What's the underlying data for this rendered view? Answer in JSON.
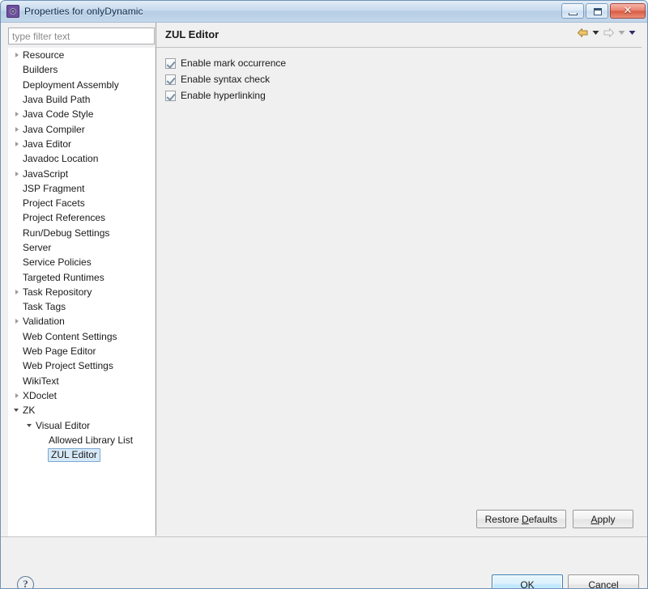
{
  "window": {
    "title": "Properties for onlyDynamic",
    "icon": "properties-gear-icon",
    "minimize_label": "Minimize",
    "maximize_label": "Maximize",
    "close_label": "✕"
  },
  "filter": {
    "placeholder": "type filter text",
    "value": ""
  },
  "tree": {
    "items": [
      {
        "label": "Resource",
        "indent": 0,
        "twisty": "collapsed",
        "selected": false
      },
      {
        "label": "Builders",
        "indent": 0,
        "twisty": "none",
        "selected": false
      },
      {
        "label": "Deployment Assembly",
        "indent": 0,
        "twisty": "none",
        "selected": false
      },
      {
        "label": "Java Build Path",
        "indent": 0,
        "twisty": "none",
        "selected": false
      },
      {
        "label": "Java Code Style",
        "indent": 0,
        "twisty": "collapsed",
        "selected": false
      },
      {
        "label": "Java Compiler",
        "indent": 0,
        "twisty": "collapsed",
        "selected": false
      },
      {
        "label": "Java Editor",
        "indent": 0,
        "twisty": "collapsed",
        "selected": false
      },
      {
        "label": "Javadoc Location",
        "indent": 0,
        "twisty": "none",
        "selected": false
      },
      {
        "label": "JavaScript",
        "indent": 0,
        "twisty": "collapsed",
        "selected": false
      },
      {
        "label": "JSP Fragment",
        "indent": 0,
        "twisty": "none",
        "selected": false
      },
      {
        "label": "Project Facets",
        "indent": 0,
        "twisty": "none",
        "selected": false
      },
      {
        "label": "Project References",
        "indent": 0,
        "twisty": "none",
        "selected": false
      },
      {
        "label": "Run/Debug Settings",
        "indent": 0,
        "twisty": "none",
        "selected": false
      },
      {
        "label": "Server",
        "indent": 0,
        "twisty": "none",
        "selected": false
      },
      {
        "label": "Service Policies",
        "indent": 0,
        "twisty": "none",
        "selected": false
      },
      {
        "label": "Targeted Runtimes",
        "indent": 0,
        "twisty": "none",
        "selected": false
      },
      {
        "label": "Task Repository",
        "indent": 0,
        "twisty": "collapsed",
        "selected": false
      },
      {
        "label": "Task Tags",
        "indent": 0,
        "twisty": "none",
        "selected": false
      },
      {
        "label": "Validation",
        "indent": 0,
        "twisty": "collapsed",
        "selected": false
      },
      {
        "label": "Web Content Settings",
        "indent": 0,
        "twisty": "none",
        "selected": false
      },
      {
        "label": "Web Page Editor",
        "indent": 0,
        "twisty": "none",
        "selected": false
      },
      {
        "label": "Web Project Settings",
        "indent": 0,
        "twisty": "none",
        "selected": false
      },
      {
        "label": "WikiText",
        "indent": 0,
        "twisty": "none",
        "selected": false
      },
      {
        "label": "XDoclet",
        "indent": 0,
        "twisty": "collapsed",
        "selected": false
      },
      {
        "label": "ZK",
        "indent": 0,
        "twisty": "expanded",
        "selected": false
      },
      {
        "label": "Visual Editor",
        "indent": 1,
        "twisty": "expanded",
        "selected": false
      },
      {
        "label": "Allowed Library List",
        "indent": 2,
        "twisty": "none",
        "selected": false
      },
      {
        "label": "ZUL Editor",
        "indent": 2,
        "twisty": "none",
        "selected": true
      }
    ]
  },
  "page": {
    "title": "ZUL Editor",
    "nav": {
      "back_icon": "back-arrow-icon",
      "back_menu_icon": "chevron-down-icon",
      "forward_icon": "forward-arrow-icon",
      "forward_menu_icon": "chevron-down-icon",
      "view_menu_icon": "chevron-down-icon"
    },
    "options": [
      {
        "label": "Enable mark occurrence",
        "checked": true
      },
      {
        "label": "Enable syntax check",
        "checked": true
      },
      {
        "label": "Enable hyperlinking",
        "checked": true
      }
    ],
    "restore_defaults_label": "Restore Defaults",
    "restore_defaults_mnemonic": "D",
    "apply_label": "Apply",
    "apply_mnemonic": "A"
  },
  "footer": {
    "help_label": "?",
    "ok_label": "OK",
    "cancel_label": "Cancel"
  },
  "colors": {
    "accent_blue": "#3c7fb1",
    "selection_bg": "#d7e8f7",
    "selection_border": "#7ba7d0",
    "panel_bg": "#f0f0f0",
    "tree_bg": "#ffffff",
    "titlebar_blue": "#b9cee4",
    "close_red": "#d85a43",
    "back_arrow_gold": "#e8b659",
    "forward_arrow_gray": "#d4d4d4",
    "check_mark": "#7b8fa6"
  }
}
